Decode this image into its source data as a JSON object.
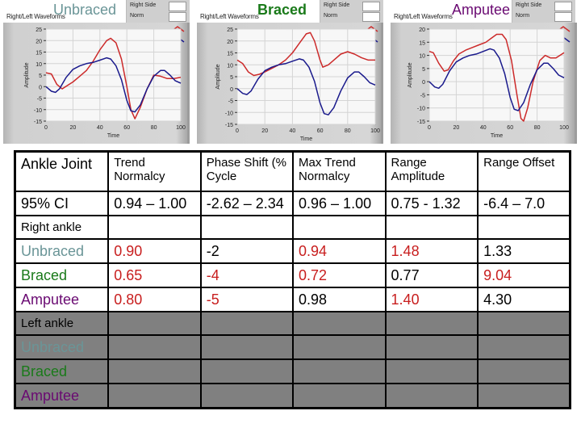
{
  "colors": {
    "unbraced": "#6a9597",
    "braced": "#1a7a1a",
    "amputee": "#6a0a72",
    "highlight_red": "#c81e1e",
    "right_side_line": "#cc2a2a",
    "norm_line": "#1a1a8c"
  },
  "chart_data": [
    {
      "type": "line",
      "title": "Unbraced",
      "subtitle": "Right/Left Waveforms",
      "xlabel": "Time",
      "ylabel": "Amplitude",
      "xlim": [
        0,
        100
      ],
      "ylim": [
        -15,
        25
      ],
      "xticks": [
        "0",
        "20",
        "40",
        "60",
        "80",
        "100"
      ],
      "yticks": [
        "25",
        "20",
        "15",
        "10",
        "5",
        "0",
        "-5",
        "-10",
        "-15"
      ],
      "ytick_values": [
        25,
        20,
        15,
        10,
        5,
        0,
        -5,
        -10,
        -15
      ],
      "grid": true,
      "legend": {
        "position": "top-right",
        "entries": [
          "Right Side",
          "Norm"
        ]
      },
      "series": [
        {
          "name": "Right Side",
          "x": [
            0,
            4,
            8,
            12,
            16,
            20,
            25,
            30,
            35,
            40,
            45,
            48,
            52,
            56,
            60,
            63,
            66,
            70,
            75,
            80,
            85,
            90,
            95,
            100
          ],
          "y": [
            6,
            5.5,
            1,
            -1,
            0.5,
            2,
            4.5,
            7,
            11,
            16,
            20,
            21,
            19,
            12,
            0,
            -10,
            -14,
            -9,
            -1,
            5,
            4.5,
            3.5,
            3.5,
            4
          ]
        },
        {
          "name": "Norm",
          "x": [
            0,
            4,
            7,
            10,
            15,
            20,
            25,
            30,
            35,
            40,
            45,
            48,
            52,
            56,
            60,
            63,
            66,
            70,
            75,
            80,
            85,
            88,
            92,
            96,
            100
          ],
          "y": [
            0,
            -2,
            -2.5,
            -1,
            4,
            7.5,
            9,
            10,
            10.5,
            11.5,
            12.5,
            12,
            9,
            3,
            -6,
            -10.5,
            -11,
            -8,
            -1,
            4.5,
            7,
            7,
            5,
            2.5,
            1.5
          ]
        }
      ]
    },
    {
      "type": "line",
      "title": "Braced",
      "subtitle": "Right/Left Waveforms",
      "xlabel": "Time",
      "ylabel": "Amplitude",
      "xlim": [
        0,
        100
      ],
      "ylim": [
        -15,
        25
      ],
      "xticks": [
        "0",
        "20",
        "40",
        "60",
        "80",
        "100"
      ],
      "yticks": [
        "25",
        "20",
        "15",
        "10",
        "5",
        "0",
        "-5",
        "-10",
        "-15"
      ],
      "ytick_values": [
        25,
        20,
        15,
        10,
        5,
        0,
        -5,
        -10,
        -15
      ],
      "grid": true,
      "legend": {
        "position": "top-right",
        "entries": [
          "Right Side",
          "Norm"
        ]
      },
      "series": [
        {
          "name": "Right Side",
          "x": [
            0,
            4,
            8,
            12,
            16,
            20,
            25,
            30,
            35,
            40,
            45,
            50,
            53,
            56,
            60,
            62,
            66,
            70,
            75,
            80,
            85,
            90,
            95,
            100
          ],
          "y": [
            12,
            10.5,
            7,
            5.5,
            6,
            7,
            8.5,
            10,
            12,
            15,
            19,
            23,
            23.5,
            20,
            12,
            9,
            10,
            12,
            14.5,
            15.5,
            14.5,
            13,
            12,
            12
          ]
        },
        {
          "name": "Norm",
          "x": [
            0,
            4,
            7,
            10,
            15,
            20,
            25,
            30,
            35,
            40,
            45,
            48,
            52,
            56,
            60,
            63,
            66,
            70,
            75,
            80,
            85,
            88,
            92,
            96,
            100
          ],
          "y": [
            0,
            -2,
            -2.5,
            -1,
            4,
            7.5,
            9,
            10,
            10.5,
            11.5,
            12.5,
            12,
            9,
            3,
            -6,
            -10.5,
            -11,
            -8,
            -1,
            4.5,
            7,
            7,
            5,
            2.5,
            1.5
          ]
        }
      ]
    },
    {
      "type": "line",
      "title": "Amputee",
      "subtitle": "Right/Left Waveforms",
      "xlabel": "Time",
      "ylabel": "Amplitude",
      "xlim": [
        0,
        100
      ],
      "ylim": [
        -15,
        20
      ],
      "xticks": [
        "0",
        "20",
        "40",
        "60",
        "80",
        "100"
      ],
      "yticks": [
        "20",
        "15",
        "10",
        "5",
        "0",
        "-5",
        "-10",
        "-15"
      ],
      "ytick_values": [
        20,
        15,
        10,
        5,
        0,
        -5,
        -10,
        -15
      ],
      "grid": true,
      "legend": {
        "position": "top-right",
        "entries": [
          "Right Side",
          "Norm"
        ]
      },
      "series": [
        {
          "name": "Right Side",
          "x": [
            0,
            3,
            7,
            11,
            14,
            18,
            22,
            27,
            32,
            37,
            42,
            46,
            50,
            54,
            57,
            61,
            65,
            68,
            70,
            73,
            77,
            82,
            86,
            90,
            94,
            100
          ],
          "y": [
            11.5,
            11,
            7,
            4,
            4.5,
            8,
            10.5,
            12,
            13,
            14,
            15,
            16.5,
            18,
            18,
            16,
            8,
            -5,
            -14,
            -15,
            -10,
            0,
            8,
            10,
            9,
            9,
            11
          ]
        },
        {
          "name": "Norm",
          "x": [
            0,
            4,
            7,
            10,
            15,
            20,
            25,
            30,
            35,
            40,
            45,
            48,
            52,
            56,
            60,
            63,
            66,
            70,
            75,
            80,
            85,
            88,
            92,
            96,
            100
          ],
          "y": [
            0,
            -2,
            -2.5,
            -1,
            4,
            7.5,
            9,
            10,
            10.5,
            11.5,
            12.5,
            12,
            9,
            3,
            -6,
            -10.5,
            -11,
            -8,
            -1,
            4.5,
            7,
            7,
            5,
            2.5,
            1.5
          ]
        }
      ]
    }
  ],
  "table": {
    "header": [
      "Ankle Joint",
      "Trend Normalcy",
      "Phase Shift (% Cycle",
      "Max Trend Normalcy",
      "Range Amplitude",
      "Range Offset"
    ],
    "ci_row": {
      "label": "95% CI",
      "values": [
        "0.94 – 1.00",
        "-2.62 – 2.34",
        "0.96 – 1.00",
        "0.75 - 1.32",
        "-6.4 – 7.0"
      ]
    },
    "right_section_label": "Right ankle",
    "right_rows": [
      {
        "label": "Unbraced",
        "values": [
          "0.90",
          "-2",
          "0.94",
          "1.48",
          "1.33"
        ],
        "red": [
          true,
          false,
          true,
          true,
          false
        ]
      },
      {
        "label": "Braced",
        "values": [
          "0.65",
          "-4",
          "0.72",
          "0.77",
          "9.04"
        ],
        "red": [
          true,
          true,
          true,
          false,
          true
        ]
      },
      {
        "label": "Amputee",
        "values": [
          "0.80",
          "-5",
          "0.98",
          "1.40",
          "4.30"
        ],
        "red": [
          true,
          true,
          false,
          true,
          false
        ]
      }
    ],
    "left_section_label": "Left ankle",
    "left_rows": [
      {
        "label": "Unbraced"
      },
      {
        "label": "Braced"
      },
      {
        "label": "Amputee"
      }
    ]
  }
}
